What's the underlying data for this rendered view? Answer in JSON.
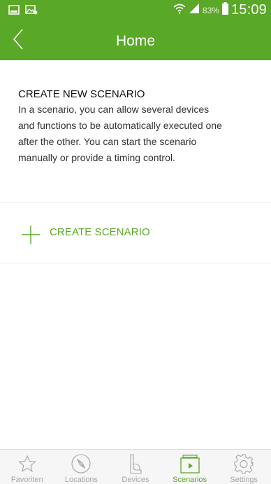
{
  "status_bar": {
    "battery_percent": "83%",
    "time": "15:09",
    "icons": [
      "gallery-notification-icon",
      "image-notification-icon",
      "wifi-icon",
      "signal-icon",
      "battery-icon"
    ]
  },
  "header": {
    "title": "Home",
    "back_icon": "chevron-left-icon"
  },
  "intro": {
    "heading": "CREATE NEW SCENARIO",
    "body": "In a scenario, you can allow several devices and functions to be automatically executed one after the other. You can start the scenario manually or provide a timing control."
  },
  "actions": {
    "create_label": "CREATE SCENARIO",
    "create_icon": "plus-icon"
  },
  "tabs": [
    {
      "label": "Favoriten",
      "icon": "star-icon",
      "active": false
    },
    {
      "label": "Locations",
      "icon": "compass-icon",
      "active": false
    },
    {
      "label": "Devices",
      "icon": "plug-icon",
      "active": false
    },
    {
      "label": "Scenarios",
      "icon": "play-box-icon",
      "active": true
    },
    {
      "label": "Settings",
      "icon": "gear-icon",
      "active": false
    }
  ],
  "colors": {
    "brand_green": "#5aa827",
    "tab_inactive": "#a5a5a5",
    "divider": "#ececec"
  }
}
